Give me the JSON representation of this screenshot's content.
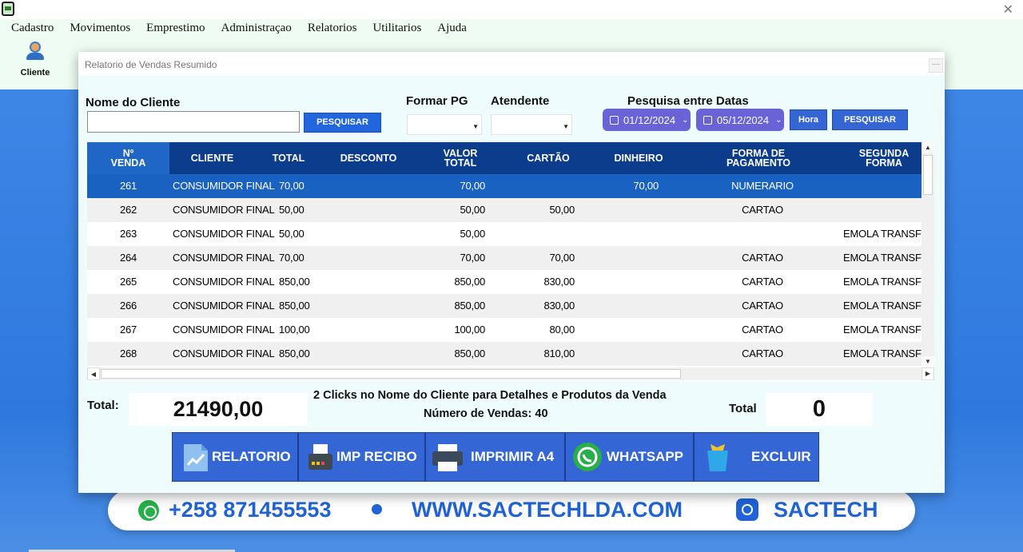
{
  "menu": [
    "Cadastro",
    "Movimentos",
    "Emprestimo",
    "Administraçao",
    "Relatorios",
    "Utilitarios",
    "Ajuda"
  ],
  "toolbar": {
    "cliente_label": "Cliente"
  },
  "dialog": {
    "title": "Relatorio de Vendas Resumido",
    "nome_cliente_label": "Nome do Cliente",
    "nome_cliente_value": "",
    "pesquisar_label": "PESQUISAR",
    "formar_pg_label": "Formar PG",
    "formar_pg_value": "",
    "atendente_label": "Atendente",
    "atendente_value": "",
    "pesquisa_datas_label": "Pesquisa entre Datas",
    "date_from": "01/12/2024",
    "date_to": "05/12/2024",
    "hora_label": "Hora",
    "pesquisar2_label": "PESQUISAR"
  },
  "table": {
    "headers": [
      "Nº\nVENDA",
      "CLIENTE",
      "TOTAL",
      "DESCONTO",
      "VALOR\nTOTAL",
      "CARTÃO",
      "DINHEIRO",
      "FORMA DE\nPAGAMENTO",
      "SEGUNDA\nFORMA"
    ],
    "rows": [
      {
        "venda": "261",
        "cliente": "CONSUMIDOR FINAL",
        "total": "70,00",
        "desconto": "",
        "valor_total": "70,00",
        "cartao": "",
        "dinheiro": "70,00",
        "forma": "NUMERARIO",
        "segunda": ""
      },
      {
        "venda": "262",
        "cliente": "CONSUMIDOR FINAL",
        "total": "50,00",
        "desconto": "",
        "valor_total": "50,00",
        "cartao": "50,00",
        "dinheiro": "",
        "forma": "CARTAO",
        "segunda": ""
      },
      {
        "venda": "263",
        "cliente": "CONSUMIDOR FINAL",
        "total": "50,00",
        "desconto": "",
        "valor_total": "50,00",
        "cartao": "",
        "dinheiro": "",
        "forma": "",
        "segunda": "EMOLA TRANSFERE"
      },
      {
        "venda": "264",
        "cliente": "CONSUMIDOR FINAL",
        "total": "70,00",
        "desconto": "",
        "valor_total": "70,00",
        "cartao": "70,00",
        "dinheiro": "",
        "forma": "CARTAO",
        "segunda": "EMOLA TRANSFERE"
      },
      {
        "venda": "265",
        "cliente": "CONSUMIDOR FINAL",
        "total": "850,00",
        "desconto": "",
        "valor_total": "850,00",
        "cartao": "830,00",
        "dinheiro": "",
        "forma": "CARTAO",
        "segunda": "EMOLA TRANSFERE"
      },
      {
        "venda": "266",
        "cliente": "CONSUMIDOR FINAL",
        "total": "850,00",
        "desconto": "",
        "valor_total": "850,00",
        "cartao": "830,00",
        "dinheiro": "",
        "forma": "CARTAO",
        "segunda": "EMOLA TRANSFERE"
      },
      {
        "venda": "267",
        "cliente": "CONSUMIDOR FINAL",
        "total": "100,00",
        "desconto": "",
        "valor_total": "100,00",
        "cartao": "80,00",
        "dinheiro": "",
        "forma": "CARTAO",
        "segunda": "EMOLA TRANSFERE"
      },
      {
        "venda": "268",
        "cliente": "CONSUMIDOR FINAL",
        "total": "850,00",
        "desconto": "",
        "valor_total": "850,00",
        "cartao": "810,00",
        "dinheiro": "",
        "forma": "CARTAO",
        "segunda": "EMOLA TRANSFERE"
      }
    ],
    "selected_index": 0
  },
  "summary": {
    "total_label": "Total:",
    "total_value": "21490,00",
    "hint": "2 Clicks no Nome do Cliente para  Detalhes e Produtos da Venda",
    "num_vendas": "Número de Vendas: 40",
    "total2_label": "Total",
    "total2_value": "0"
  },
  "actions": {
    "relatorio": "RELATORIO",
    "imp_recibo": "IMP RECIBO",
    "imprimir_a4": "IMPRIMIR A4",
    "whatsapp": "WHATSAPP",
    "excluir": "EXCLUIR"
  },
  "banner": {
    "phone": "+258 871455553",
    "site": "WWW.SACTECHLDA.COM",
    "brand": "SACTECH"
  },
  "colors": {
    "header_dark": "#0b3d8c",
    "selected_row": "#1a62c2",
    "button_blue": "#3466d6",
    "date_pill": "#6a63d8",
    "banner_text": "#1f63d6"
  }
}
